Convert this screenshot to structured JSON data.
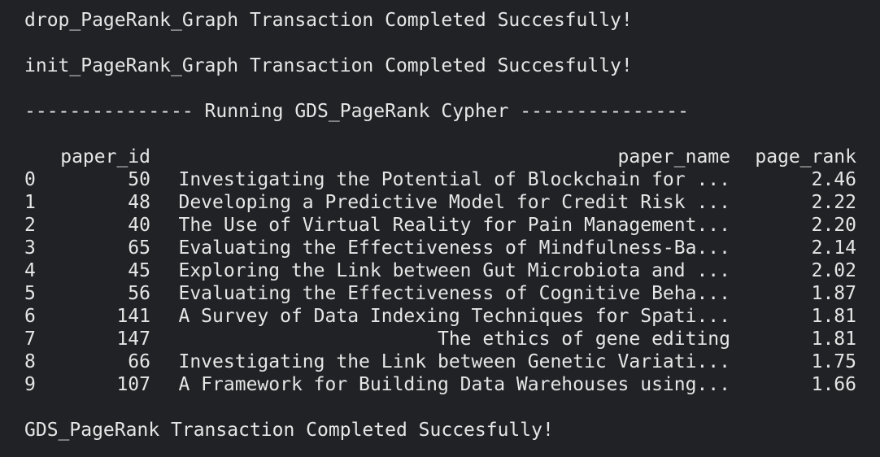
{
  "output": {
    "line1": "drop_PageRank_Graph Transaction Completed Succesfully!",
    "line2": "init_PageRank_Graph Transaction Completed Succesfully!",
    "line3": "--------------- Running GDS_PageRank Cypher ---------------",
    "line4": "GDS_PageRank Transaction Completed Succesfully!"
  },
  "table": {
    "headers": {
      "paper_id": "paper_id",
      "paper_name": "paper_name",
      "page_rank": "page_rank"
    },
    "rows": [
      {
        "idx": "0",
        "paper_id": "50",
        "paper_name": "Investigating the Potential of Blockchain for ...",
        "page_rank": "2.46"
      },
      {
        "idx": "1",
        "paper_id": "48",
        "paper_name": "Developing a Predictive Model for Credit Risk ...",
        "page_rank": "2.22"
      },
      {
        "idx": "2",
        "paper_id": "40",
        "paper_name": "The Use of Virtual Reality for Pain Management...",
        "page_rank": "2.20"
      },
      {
        "idx": "3",
        "paper_id": "65",
        "paper_name": "Evaluating the Effectiveness of Mindfulness-Ba...",
        "page_rank": "2.14"
      },
      {
        "idx": "4",
        "paper_id": "45",
        "paper_name": "Exploring the Link between Gut Microbiota and ...",
        "page_rank": "2.02"
      },
      {
        "idx": "5",
        "paper_id": "56",
        "paper_name": "Evaluating the Effectiveness of Cognitive Beha...",
        "page_rank": "1.87"
      },
      {
        "idx": "6",
        "paper_id": "141",
        "paper_name": "A Survey of Data Indexing Techniques for Spati...",
        "page_rank": "1.81"
      },
      {
        "idx": "7",
        "paper_id": "147",
        "paper_name": "The ethics of gene editing",
        "page_rank": "1.81"
      },
      {
        "idx": "8",
        "paper_id": "66",
        "paper_name": "Investigating the Link between Genetic Variati...",
        "page_rank": "1.75"
      },
      {
        "idx": "9",
        "paper_id": "107",
        "paper_name": "A Framework for Building Data Warehouses using...",
        "page_rank": "1.66"
      }
    ]
  },
  "colors": {
    "background": "#212226",
    "text": "#e6e6e6"
  }
}
